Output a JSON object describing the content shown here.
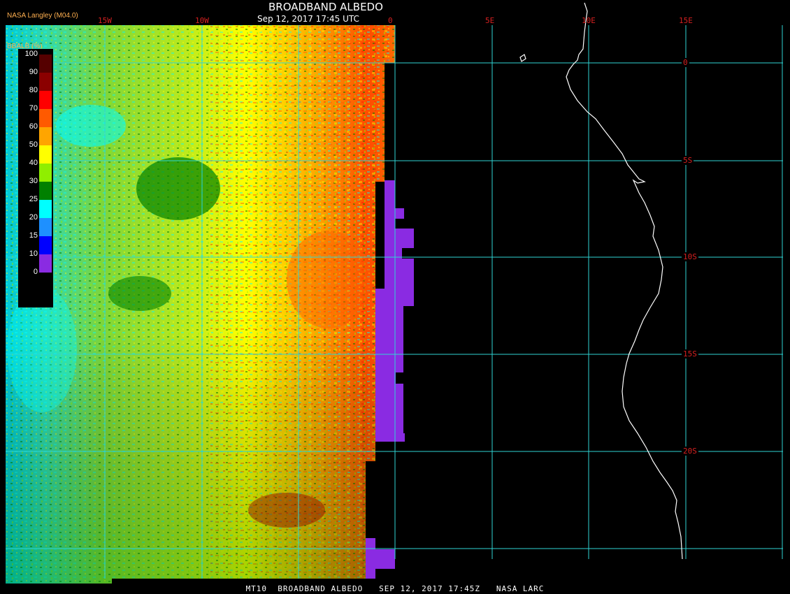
{
  "title": "BROADBAND ALBEDO",
  "subtitle": "Sep 12, 2017 17:45 UTC",
  "agency_label": "NASA Langley (M04.0)",
  "unit_label": "BBALB (%)",
  "footer": "MT10  BROADBAND ALBEDO   SEP 12, 2017 17:45Z   NASA LARC",
  "colorbar": [
    {
      "label": "100",
      "color": "#550000"
    },
    {
      "label": "90",
      "color": "#8b0000"
    },
    {
      "label": "80",
      "color": "#ff0000"
    },
    {
      "label": "70",
      "color": "#ff5a00"
    },
    {
      "label": "60",
      "color": "#ffa500"
    },
    {
      "label": "50",
      "color": "#ffff00"
    },
    {
      "label": "40",
      "color": "#90ee00"
    },
    {
      "label": "30",
      "color": "#008000"
    },
    {
      "label": "25",
      "color": "#00ffff"
    },
    {
      "label": "20",
      "color": "#1e90ff"
    },
    {
      "label": "15",
      "color": "#0000ff"
    },
    {
      "label": "10",
      "color": "#8a2be2"
    },
    {
      "label": "0",
      "color": ""
    }
  ],
  "lon_labels": [
    "15W",
    "10W",
    "0",
    "5E",
    "10E",
    "15E"
  ],
  "lat_labels": [
    "0",
    "5S",
    "10S",
    "15S",
    "20S"
  ],
  "colors": {
    "grid": "#2fd4d4",
    "coastline": "#ffffff",
    "labels": "#d62020",
    "background": "#000000",
    "nodata": "#8a2be2"
  }
}
